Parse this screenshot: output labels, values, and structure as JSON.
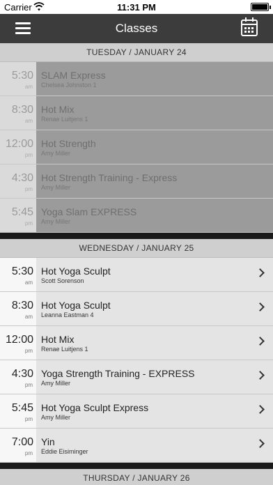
{
  "status_bar": {
    "carrier": "Carrier",
    "time": "11:31 PM"
  },
  "nav": {
    "title": "Classes"
  },
  "days": [
    {
      "header": "TUESDAY / JANUARY 24",
      "past": true,
      "classes": [
        {
          "time": "5:30",
          "ampm": "am",
          "name": "SLAM Express",
          "instructor": "Chelsea Johnston 1"
        },
        {
          "time": "8:30",
          "ampm": "am",
          "name": "Hot Mix",
          "instructor": "Renae Luitjens 1"
        },
        {
          "time": "12:00",
          "ampm": "pm",
          "name": "Hot Strength",
          "instructor": "Amy Miller"
        },
        {
          "time": "4:30",
          "ampm": "pm",
          "name": "Hot Strength Training - Express",
          "instructor": "Amy Miller"
        },
        {
          "time": "5:45",
          "ampm": "pm",
          "name": "Yoga Slam EXPRESS",
          "instructor": "Amy Miller"
        }
      ]
    },
    {
      "header": "WEDNESDAY / JANUARY 25",
      "past": false,
      "classes": [
        {
          "time": "5:30",
          "ampm": "am",
          "name": "Hot Yoga Sculpt",
          "instructor": "Scott Sorenson"
        },
        {
          "time": "8:30",
          "ampm": "am",
          "name": "Hot Yoga Sculpt",
          "instructor": "Leanna Eastman 4"
        },
        {
          "time": "12:00",
          "ampm": "pm",
          "name": "Hot Mix",
          "instructor": "Renae Luitjens 1"
        },
        {
          "time": "4:30",
          "ampm": "pm",
          "name": "Yoga Strength Training - EXPRESS",
          "instructor": "Amy Miller"
        },
        {
          "time": "5:45",
          "ampm": "pm",
          "name": "Hot Yoga Sculpt Express",
          "instructor": "Amy Miller"
        },
        {
          "time": "7:00",
          "ampm": "pm",
          "name": "Yin",
          "instructor": "Eddie Eisiminger"
        }
      ]
    },
    {
      "header": "THURSDAY / JANUARY 26",
      "past": false,
      "classes": []
    }
  ]
}
